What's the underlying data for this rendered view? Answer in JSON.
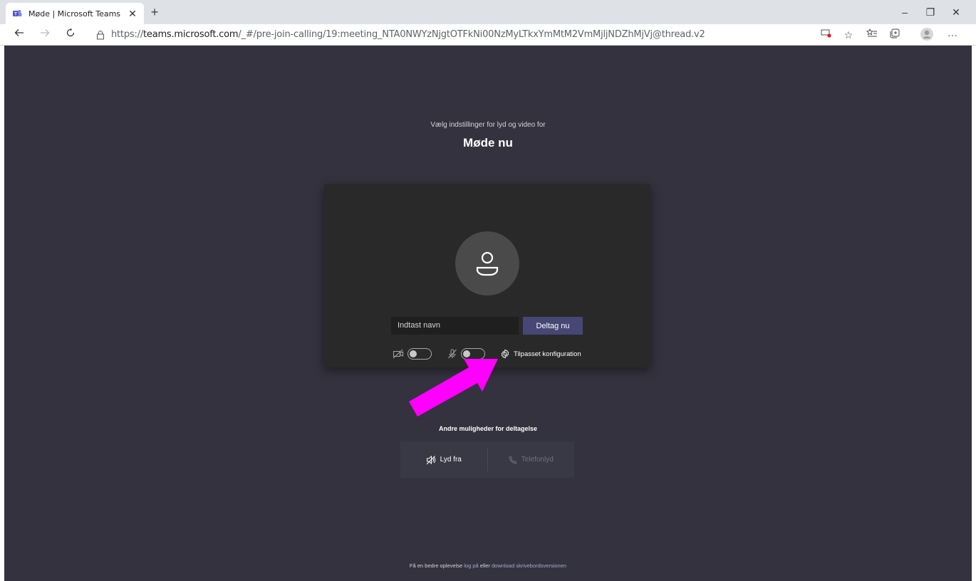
{
  "browser": {
    "tab_title": "Møde | Microsoft Teams",
    "tab_close": "✕",
    "new_tab": "+",
    "url_prefix": "https://",
    "url_host": "teams.microsoft.com",
    "url_path": "/_#/pre-join-calling/19:meeting_NTA0NWYzNjgtOTFkNi00NzMyLTkxYmMtM2VmMjljNDZhMjVj@thread.v2",
    "window_controls": {
      "minimize": "–",
      "restore": "❐",
      "close": "✕"
    },
    "more_menu": "···"
  },
  "prejoin": {
    "subtitle": "Vælg indstillinger for lyd og video for",
    "meeting_title": "Møde nu",
    "name_placeholder": "Indtast navn",
    "join_button": "Deltag nu",
    "camera_toggle": "off",
    "mic_toggle": "off",
    "custom_setup": "Tilpasset konfiguration"
  },
  "other_options": {
    "title": "Andre muligheder for deltagelse",
    "audio_off": "Lyd fra",
    "phone_audio": "Telefonlyd"
  },
  "footer": {
    "text_before": "Få en bedre oplevelse ",
    "login_link": "log på",
    "text_middle": " eller ",
    "download_link": "download skrivebordsversionen"
  },
  "colors": {
    "page_bg": "#33323e",
    "card_bg": "#292929",
    "join_button": "#464775",
    "annotation_arrow": "#ff00ff"
  }
}
